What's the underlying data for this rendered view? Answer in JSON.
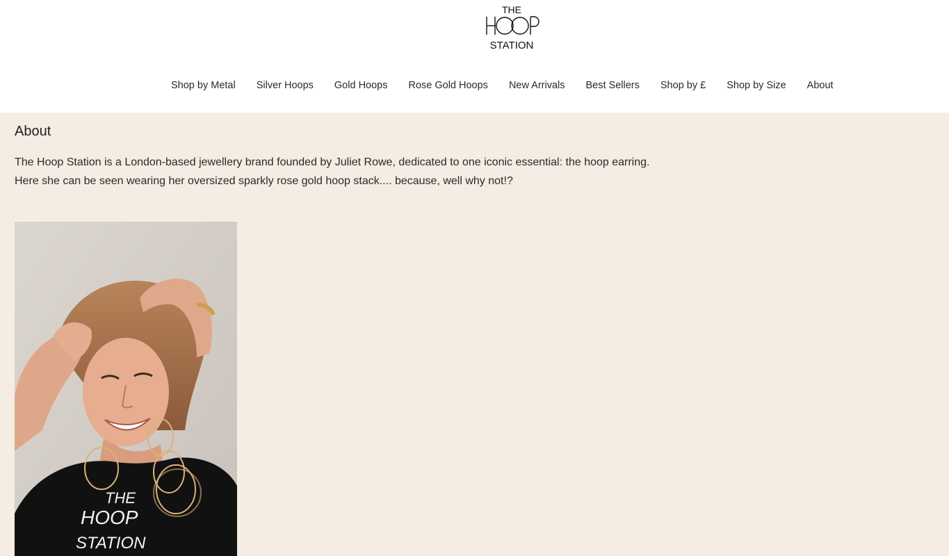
{
  "header": {
    "logo": {
      "line1": "THE",
      "line2": "HOOP",
      "line3": "STATION"
    },
    "nav": [
      {
        "label": "Shop by Metal"
      },
      {
        "label": "Silver Hoops"
      },
      {
        "label": "Gold Hoops"
      },
      {
        "label": "Rose Gold Hoops"
      },
      {
        "label": "New Arrivals"
      },
      {
        "label": "Best Sellers"
      },
      {
        "label": "Shop by £"
      },
      {
        "label": "Shop by Size"
      },
      {
        "label": "About"
      }
    ]
  },
  "main": {
    "title": "About",
    "paragraphs": [
      "The Hoop Station is a London-based jewellery brand founded by Juliet Rowe, dedicated to one iconic essential: the hoop earring.",
      "Here she can be seen wearing her oversized sparkly rose gold hoop stack.... because, well why not!?"
    ],
    "photo": {
      "shirt_print": [
        "THE",
        "HOOP",
        "STATION"
      ]
    }
  },
  "colors": {
    "page_background": "#f5ece3",
    "header_background": "#ffffff",
    "text": "#1e1e1e"
  }
}
